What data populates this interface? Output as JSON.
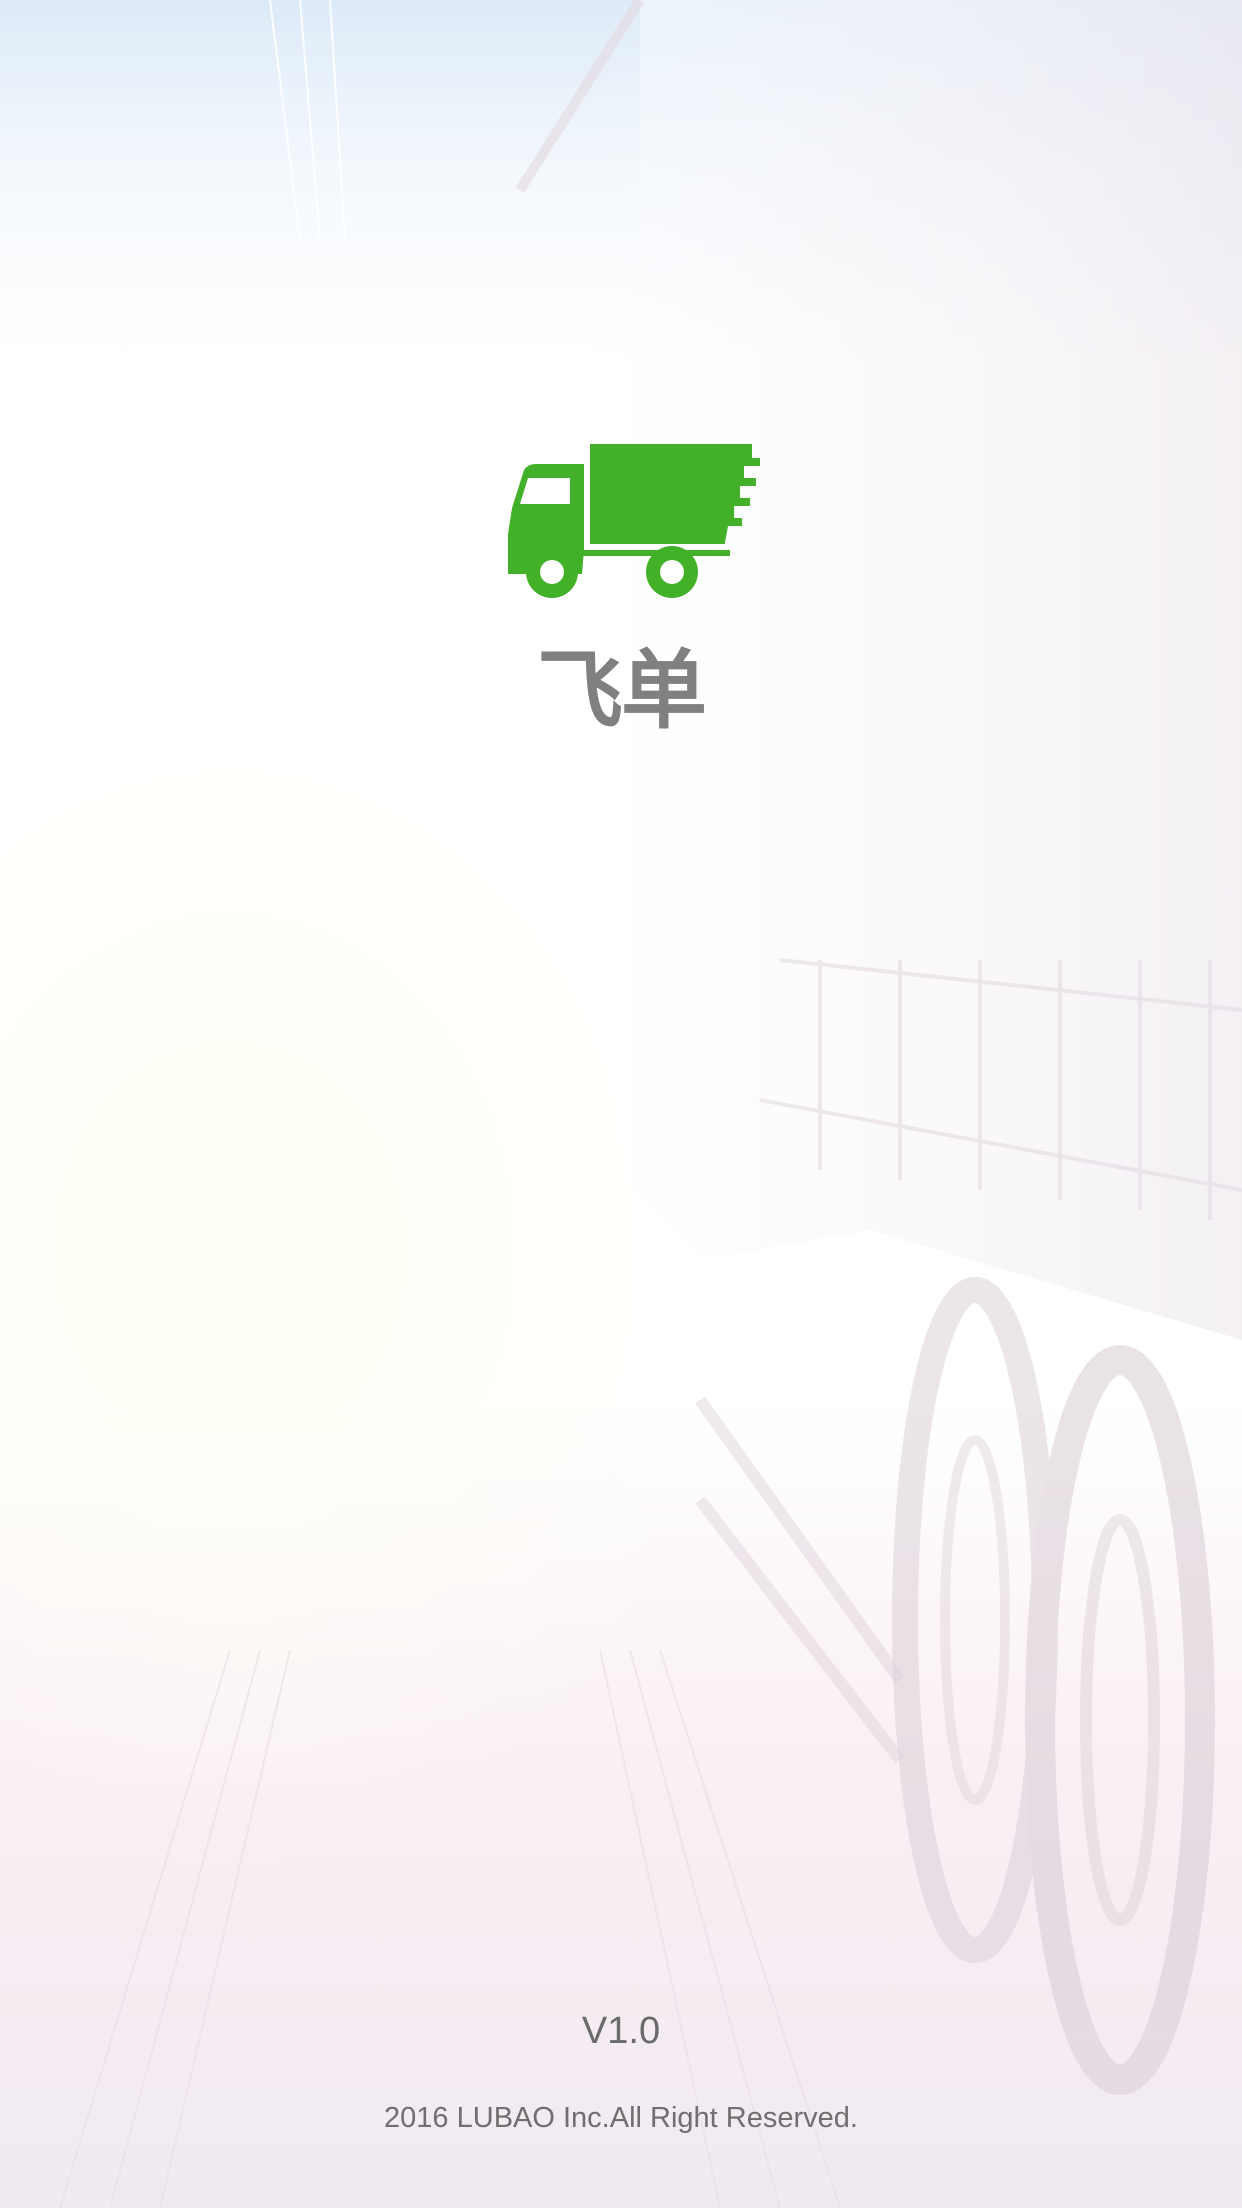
{
  "app": {
    "name": "飞单",
    "logo_icon": "truck-icon",
    "brand_color": "#43b02a"
  },
  "footer": {
    "version": "V1.0",
    "copyright": "2016 LUBAO Inc.All Right Reserved."
  }
}
